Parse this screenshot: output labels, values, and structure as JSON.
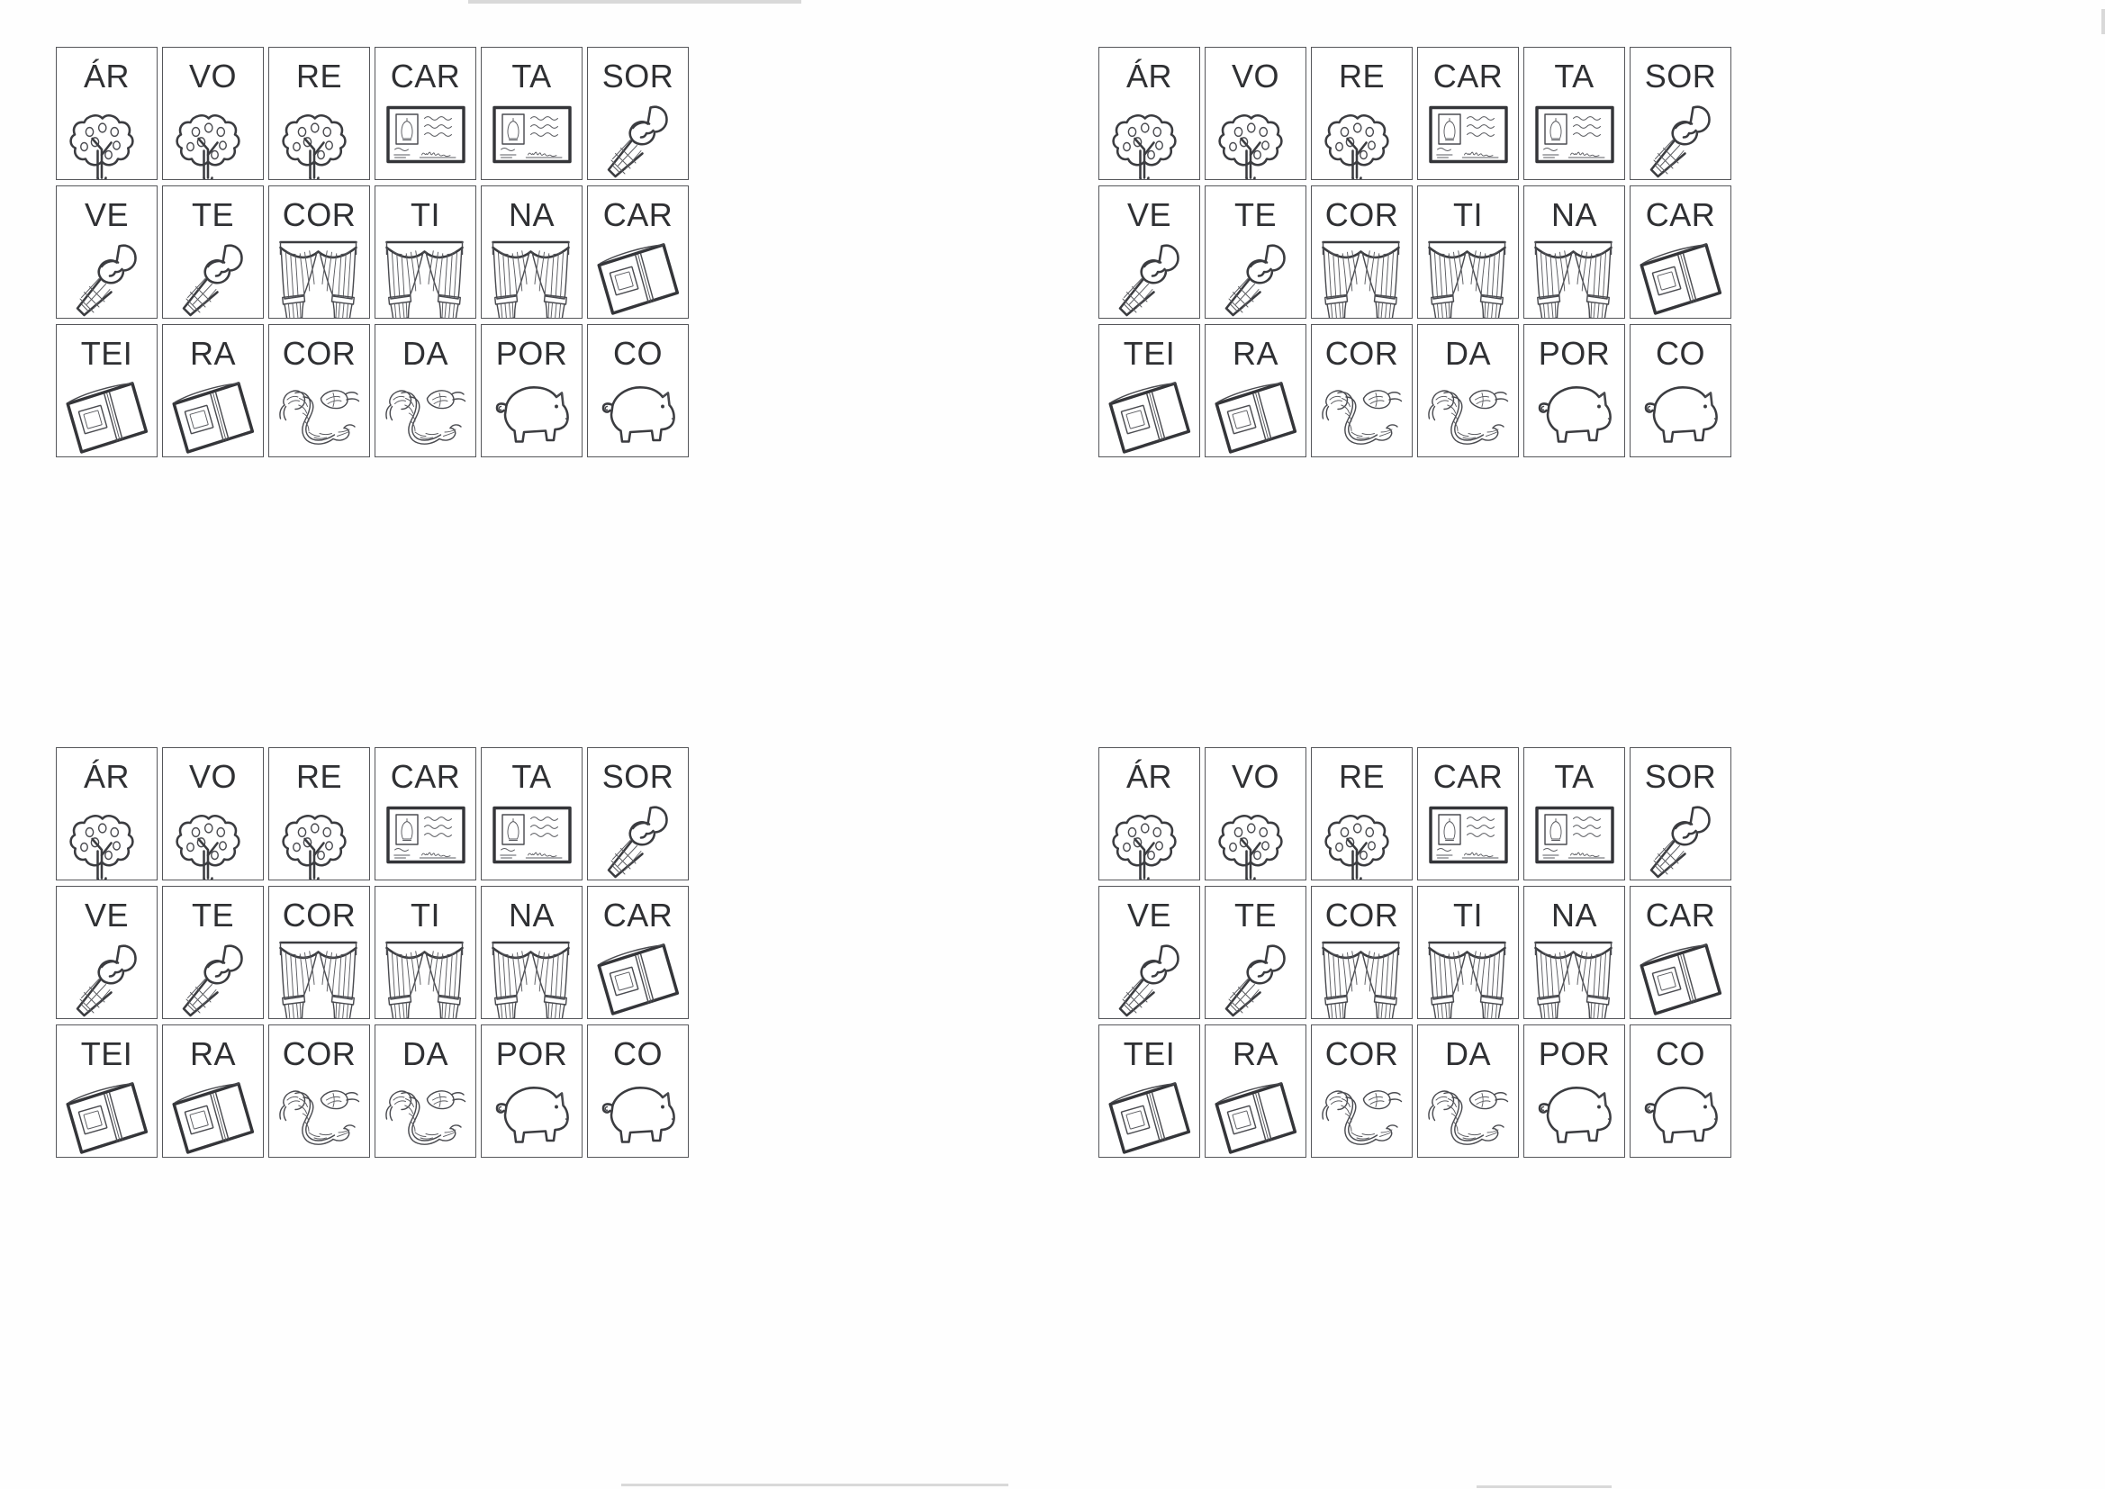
{
  "document": {
    "kind": "syllable-flashcard-worksheet",
    "quadrant_count": 4,
    "rows_per_quadrant": 3,
    "columns_per_quadrant": 6
  },
  "cards": [
    {
      "id": "c1",
      "label": "ÁR",
      "icon": "tree-icon",
      "word": "ÁRVORE"
    },
    {
      "id": "c2",
      "label": "VO",
      "icon": "tree-icon",
      "word": "ÁRVORE"
    },
    {
      "id": "c3",
      "label": "RE",
      "icon": "tree-icon",
      "word": "ÁRVORE"
    },
    {
      "id": "c4",
      "label": "CAR",
      "icon": "postcard-icon",
      "word": "CARTA"
    },
    {
      "id": "c5",
      "label": "TA",
      "icon": "postcard-icon",
      "word": "CARTA"
    },
    {
      "id": "c6",
      "label": "SOR",
      "icon": "icecream-icon",
      "word": "SORVETE"
    },
    {
      "id": "c7",
      "label": "VE",
      "icon": "icecream-icon",
      "word": "SORVETE"
    },
    {
      "id": "c8",
      "label": "TE",
      "icon": "icecream-icon",
      "word": "SORVETE"
    },
    {
      "id": "c9",
      "label": "COR",
      "icon": "curtain-icon",
      "word": "CORTINA"
    },
    {
      "id": "c10",
      "label": "TI",
      "icon": "curtain-icon",
      "word": "CORTINA"
    },
    {
      "id": "c11",
      "label": "NA",
      "icon": "curtain-icon",
      "word": "CORTINA"
    },
    {
      "id": "c12",
      "label": "CAR",
      "icon": "wallet-icon",
      "word": "CARTEIRA"
    },
    {
      "id": "c13",
      "label": "TEI",
      "icon": "wallet-icon",
      "word": "CARTEIRA"
    },
    {
      "id": "c14",
      "label": "RA",
      "icon": "wallet-icon",
      "word": "CARTEIRA"
    },
    {
      "id": "c15",
      "label": "COR",
      "icon": "rope-icon",
      "word": "CORDA"
    },
    {
      "id": "c16",
      "label": "DA",
      "icon": "rope-icon",
      "word": "CORDA"
    },
    {
      "id": "c17",
      "label": "POR",
      "icon": "pig-icon",
      "word": "PORCO"
    },
    {
      "id": "c18",
      "label": "CO",
      "icon": "pig-icon",
      "word": "PORCO"
    }
  ],
  "colors": {
    "ink": "#3b3c40",
    "card_border": "#55565a",
    "label_text": "#2f3033",
    "paper": "#ffffff"
  }
}
